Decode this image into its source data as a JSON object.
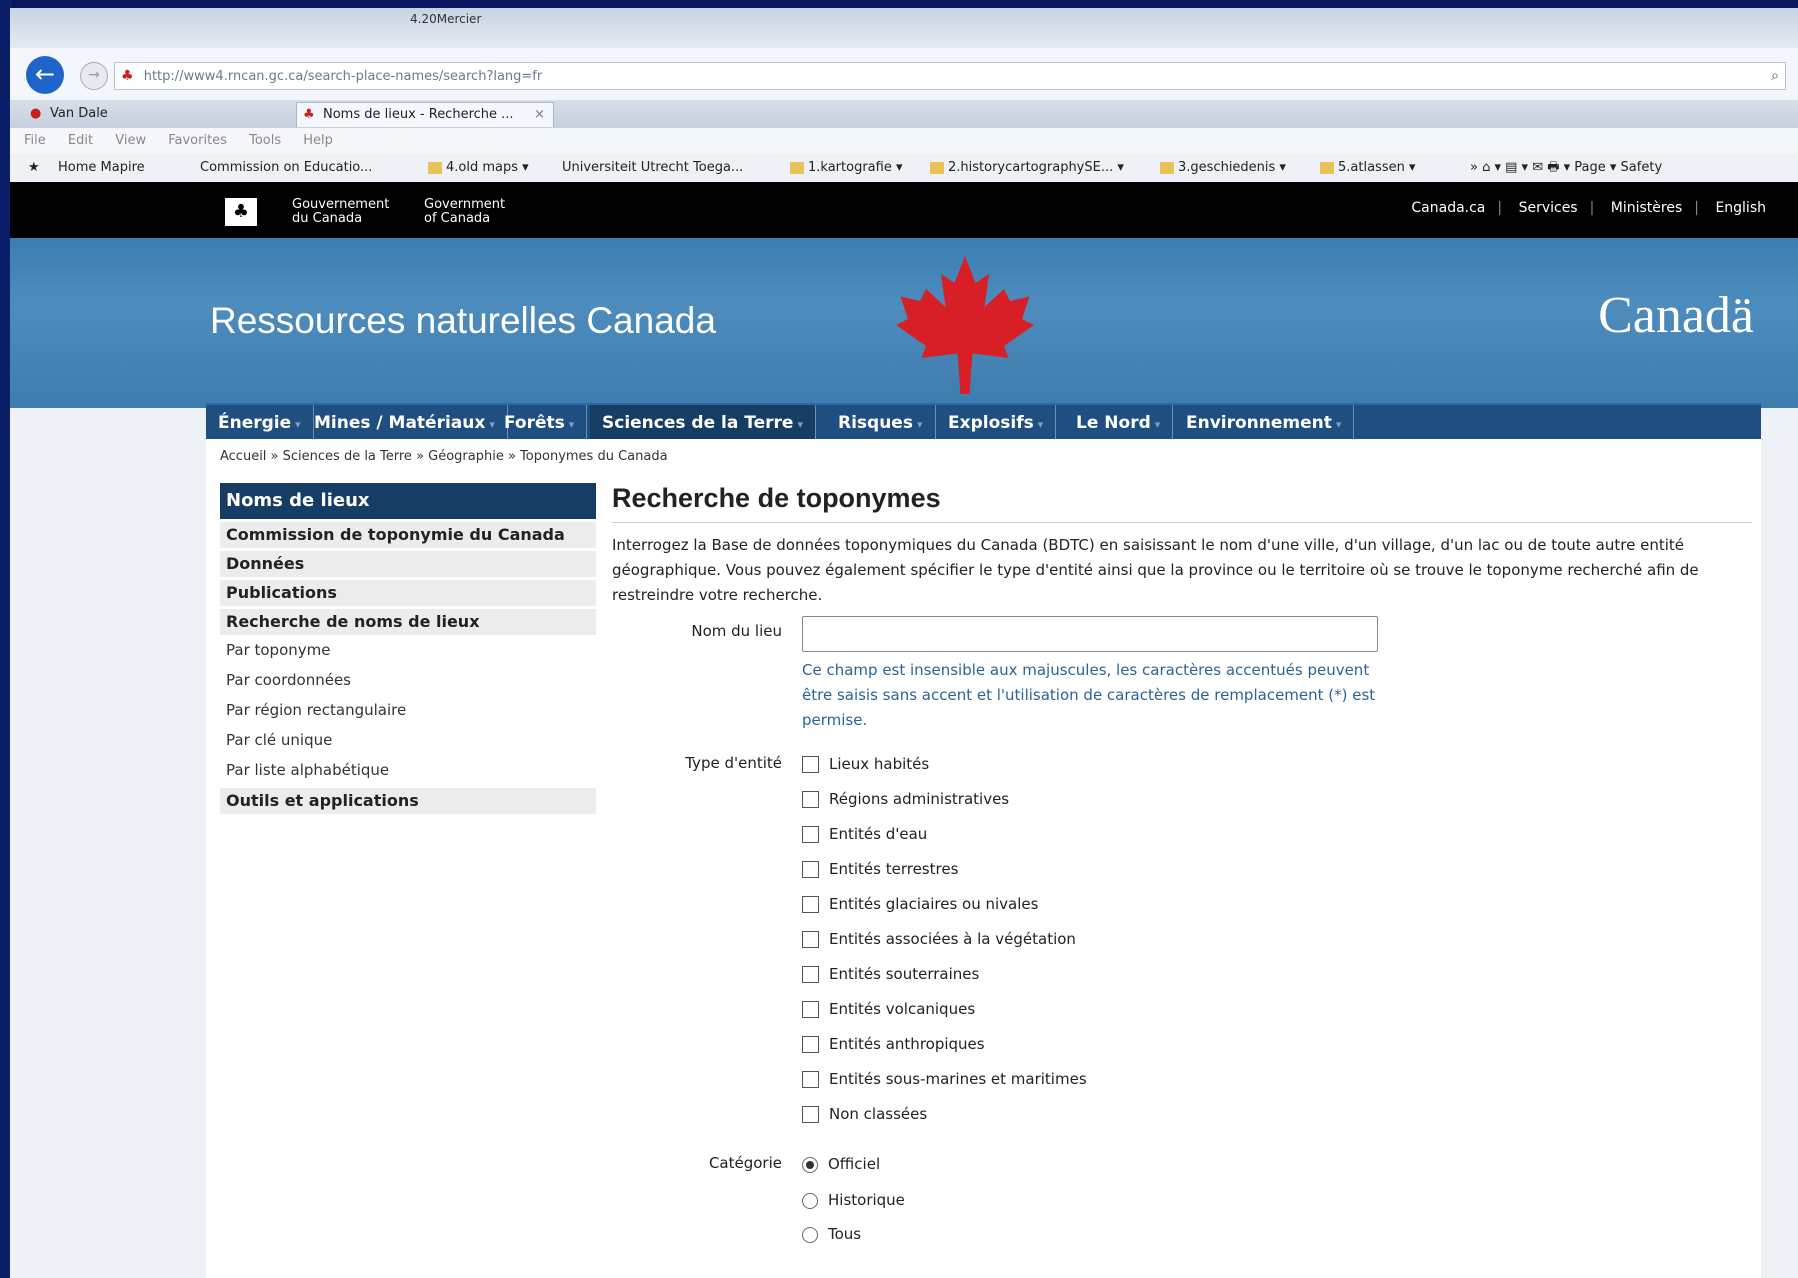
{
  "browser": {
    "window_title": "4.20Mercier",
    "url": "http://www4.rncan.gc.ca/search-place-names/search?lang=fr",
    "tabs": [
      {
        "label": "Van Dale"
      },
      {
        "label": "Noms de lieux - Recherche ..."
      }
    ],
    "menu": [
      "File",
      "Edit",
      "View",
      "Favorites",
      "Tools",
      "Help"
    ],
    "favorites": [
      "Home Mapire",
      "Commission on Educatio...",
      "4.old maps ▾",
      "Universiteit Utrecht Toega...",
      "1.kartografie ▾",
      "2.historycartographySE... ▾",
      "3.geschiedenis ▾",
      "5.atlassen ▾"
    ],
    "commands": "»  ⌂ ▾  ▤ ▾  ✉  🖶 ▾  Page ▾  Safety"
  },
  "gov": {
    "fr": [
      "Gouvernement",
      "du Canada"
    ],
    "en": [
      "Government",
      "of Canada"
    ],
    "links": [
      "Canada.ca",
      "Services",
      "Ministères",
      "English"
    ]
  },
  "banner": {
    "title": "Ressources naturelles Canada",
    "wordmark": "Canadä"
  },
  "nav": [
    "Énergie",
    "Mines / Matériaux",
    "Forêts",
    "Sciences de la Terre",
    "Risques",
    "Explosifs",
    "Le Nord",
    "Environnement"
  ],
  "breadcrumb": "Accueil » Sciences de la Terre » Géographie » Toponymes du Canada",
  "sidebar": {
    "head": "Noms de lieux",
    "items": [
      "Commission de toponymie du Canada",
      "Données",
      "Publications",
      "Recherche de noms de lieux"
    ],
    "sub": [
      "Par toponyme",
      "Par coordonnées",
      "Par région rectangulaire",
      "Par clé unique",
      "Par liste alphabétique"
    ],
    "last": "Outils et applications"
  },
  "main": {
    "title": "Recherche de toponymes",
    "intro": "Interrogez la Base de données toponymiques du Canada (BDTC) en saisissant le nom d'une ville, d'un village, d'un lac ou de toute autre entité géographique. Vous pouvez également spécifier le type d'entité ainsi que la province ou le territoire où se trouve le toponyme recherché afin de restreindre votre recherche.",
    "nom_label": "Nom du lieu",
    "nom_value": "",
    "hint": "Ce champ est insensible aux majuscules, les caractères accentués peuvent être saisis sans accent et l'utilisation de caractères de remplacement (*) est permise.",
    "type_label": "Type d'entité",
    "types": [
      "Lieux habités",
      "Régions administratives",
      "Entités d'eau",
      "Entités terrestres",
      "Entités glaciaires ou nivales",
      "Entités associées à la végétation",
      "Entités souterraines",
      "Entités volcaniques",
      "Entités anthropiques",
      "Entités sous-marines et maritimes",
      "Non classées"
    ],
    "cat_label": "Catégorie",
    "categories": [
      "Officiel",
      "Historique",
      "Tous"
    ],
    "selected_category": "Officiel"
  }
}
